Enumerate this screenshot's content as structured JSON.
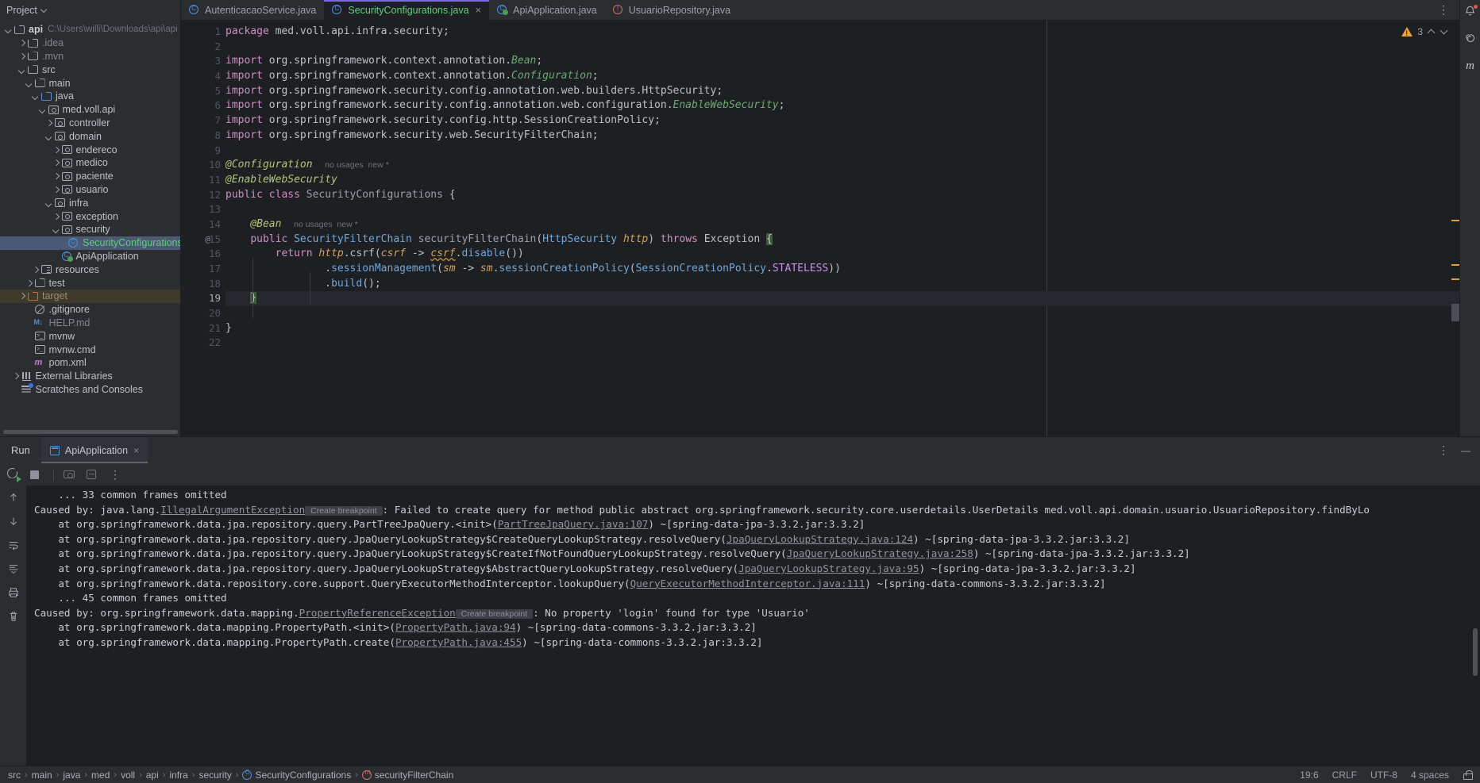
{
  "sidebar": {
    "title": "Project",
    "title_icon": "chevron-down-icon",
    "root": {
      "label": "api",
      "path": "C:\\Users\\willi\\Downloads\\api\\api"
    },
    "items": [
      {
        "label": ".idea",
        "icon": "folder-icon",
        "indent": 2,
        "arrow": "right",
        "style": "dim"
      },
      {
        "label": ".mvn",
        "icon": "folder-icon",
        "indent": 2,
        "arrow": "right",
        "style": "dim"
      },
      {
        "label": "src",
        "icon": "folder-icon",
        "indent": 2,
        "arrow": "down",
        "style": ""
      },
      {
        "label": "main",
        "icon": "folder-icon",
        "indent": 3,
        "arrow": "down",
        "style": ""
      },
      {
        "label": "java",
        "icon": "folder-blue-icon",
        "indent": 4,
        "arrow": "down",
        "style": ""
      },
      {
        "label": "med.voll.api",
        "icon": "package-icon",
        "indent": 5,
        "arrow": "down",
        "style": ""
      },
      {
        "label": "controller",
        "icon": "package-icon",
        "indent": 6,
        "arrow": "right",
        "style": ""
      },
      {
        "label": "domain",
        "icon": "package-icon",
        "indent": 6,
        "arrow": "down",
        "style": ""
      },
      {
        "label": "endereco",
        "icon": "package-icon",
        "indent": 7,
        "arrow": "right",
        "style": ""
      },
      {
        "label": "medico",
        "icon": "package-icon",
        "indent": 7,
        "arrow": "right",
        "style": ""
      },
      {
        "label": "paciente",
        "icon": "package-icon",
        "indent": 7,
        "arrow": "right",
        "style": ""
      },
      {
        "label": "usuario",
        "icon": "package-icon",
        "indent": 7,
        "arrow": "right",
        "style": ""
      },
      {
        "label": "infra",
        "icon": "package-icon",
        "indent": 6,
        "arrow": "down",
        "style": ""
      },
      {
        "label": "exception",
        "icon": "package-icon",
        "indent": 7,
        "arrow": "right",
        "style": ""
      },
      {
        "label": "security",
        "icon": "package-icon",
        "indent": 7,
        "arrow": "down",
        "style": ""
      },
      {
        "label": "SecurityConfigurations",
        "icon": "java-class-icon",
        "indent": 8,
        "arrow": "none",
        "style": "green",
        "selected": true
      },
      {
        "label": "ApiApplication",
        "icon": "spring-class-icon",
        "indent": 7,
        "arrow": "none",
        "style": ""
      },
      {
        "label": "resources",
        "icon": "resources-icon",
        "indent": 4,
        "arrow": "right",
        "style": ""
      },
      {
        "label": "test",
        "icon": "folder-icon",
        "indent": 3,
        "arrow": "right",
        "style": ""
      },
      {
        "label": "target",
        "icon": "folder-orange-icon",
        "indent": 2,
        "arrow": "right",
        "style": "tan",
        "target": true
      },
      {
        "label": ".gitignore",
        "icon": "gitignore-icon",
        "indent": 3,
        "arrow": "none",
        "style": ""
      },
      {
        "label": "HELP.md",
        "icon": "markdown-icon",
        "indent": 3,
        "arrow": "none",
        "style": "dim"
      },
      {
        "label": "mvnw",
        "icon": "terminal-icon",
        "indent": 3,
        "arrow": "none",
        "style": ""
      },
      {
        "label": "mvnw.cmd",
        "icon": "terminal-icon",
        "indent": 3,
        "arrow": "none",
        "style": ""
      },
      {
        "label": "pom.xml",
        "icon": "xml-icon",
        "indent": 3,
        "arrow": "none",
        "style": ""
      },
      {
        "label": "External Libraries",
        "icon": "library-icon",
        "indent": 1,
        "arrow": "right",
        "style": ""
      },
      {
        "label": "Scratches and Consoles",
        "icon": "scratches-icon",
        "indent": 1,
        "arrow": "none",
        "style": ""
      }
    ]
  },
  "editor": {
    "tabs": [
      {
        "label": "AutenticacaoService.java",
        "icon": "java-class-icon",
        "active": false,
        "closable": false
      },
      {
        "label": "SecurityConfigurations.java",
        "icon": "java-class-icon",
        "active": true,
        "closable": true
      },
      {
        "label": "ApiApplication.java",
        "icon": "spring-class-icon",
        "active": false,
        "closable": false
      },
      {
        "label": "UsuarioRepository.java",
        "icon": "interface-icon",
        "active": false,
        "closable": false
      }
    ],
    "tab_close_label": "×",
    "tab_menu_label": "⋮",
    "inspection": {
      "warning_count": "3",
      "icon": "warning-triangle-icon"
    },
    "line_numbers": [
      "1",
      "2",
      "3",
      "4",
      "5",
      "6",
      "7",
      "8",
      "9",
      "10",
      "11",
      "12",
      "13",
      "14",
      "15",
      "16",
      "17",
      "18",
      "19",
      "20",
      "21",
      "22"
    ],
    "current_line": 19,
    "gutter_marks": {
      "15": "@"
    },
    "code_lines": [
      "package med.voll.api.infra.security;",
      "",
      "import org.springframework.context.annotation.Bean;",
      "import org.springframework.context.annotation.Configuration;",
      "import org.springframework.security.config.annotation.web.builders.HttpSecurity;",
      "import org.springframework.security.config.annotation.web.configuration.EnableWebSecurity;",
      "import org.springframework.security.config.http.SessionCreationPolicy;",
      "import org.springframework.security.web.SecurityFilterChain;",
      "",
      "@Configuration",
      "@EnableWebSecurity",
      "public class SecurityConfigurations {",
      "",
      "    @Bean",
      "    public SecurityFilterChain securityFilterChain(HttpSecurity http) throws Exception {",
      "        return http.csrf(csrf -> csrf.disable())",
      "                .sessionManagement(sm -> sm.sessionCreationPolicy(SessionCreationPolicy.STATELESS))",
      "                .build();",
      "    }",
      "",
      "}",
      ""
    ],
    "inlay_hints": {
      "line10": "no usages   new *",
      "line14": "no usages   new *"
    }
  },
  "run": {
    "panel_title": "Run",
    "tab_label": "ApiApplication",
    "tab_close_label": "×",
    "toolbar": {
      "rerun": "rerun-icon",
      "stop": "stop-icon",
      "screenshot": "camera-icon",
      "export": "export-icon",
      "more": "⋮"
    },
    "panel_menu_label": "⋮",
    "panel_minimize_label": "—",
    "gutter_icons": [
      "arrow-up-icon",
      "arrow-down-icon",
      "soft-wrap-icon",
      "scroll-end-icon",
      "print-icon",
      "trash-icon"
    ],
    "console_lines": [
      {
        "parts": [
          {
            "t": "\t... 33 common frames omitted",
            "c": "plain"
          }
        ]
      },
      {
        "parts": [
          {
            "t": "Caused by: java.lang.",
            "c": "plain"
          },
          {
            "t": "IllegalArgumentException",
            "c": "link"
          },
          {
            "t": "Create breakpoint",
            "c": "bp"
          },
          {
            "t": ": Failed to create query for method public abstract org.springframework.security.core.userdetails.UserDetails med.voll.api.domain.usuario.UsuarioRepository.findByLo",
            "c": "plain"
          }
        ]
      },
      {
        "parts": [
          {
            "t": "\tat org.springframework.data.jpa.repository.query.PartTreeJpaQuery.<init>(",
            "c": "plain"
          },
          {
            "t": "PartTreeJpaQuery.java:107",
            "c": "link"
          },
          {
            "t": ") ~[spring-data-jpa-3.3.2.jar:3.3.2]",
            "c": "plain"
          }
        ]
      },
      {
        "parts": [
          {
            "t": "\tat org.springframework.data.jpa.repository.query.JpaQueryLookupStrategy$CreateQueryLookupStrategy.resolveQuery(",
            "c": "plain"
          },
          {
            "t": "JpaQueryLookupStrategy.java:124",
            "c": "link"
          },
          {
            "t": ") ~[spring-data-jpa-3.3.2.jar:3.3.2]",
            "c": "plain"
          }
        ]
      },
      {
        "parts": [
          {
            "t": "\tat org.springframework.data.jpa.repository.query.JpaQueryLookupStrategy$CreateIfNotFoundQueryLookupStrategy.resolveQuery(",
            "c": "plain"
          },
          {
            "t": "JpaQueryLookupStrategy.java:258",
            "c": "link"
          },
          {
            "t": ") ~[spring-data-jpa-3.3.2.jar:3.3.2]",
            "c": "plain"
          }
        ]
      },
      {
        "parts": [
          {
            "t": "\tat org.springframework.data.jpa.repository.query.JpaQueryLookupStrategy$AbstractQueryLookupStrategy.resolveQuery(",
            "c": "plain"
          },
          {
            "t": "JpaQueryLookupStrategy.java:95",
            "c": "link"
          },
          {
            "t": ") ~[spring-data-jpa-3.3.2.jar:3.3.2]",
            "c": "plain"
          }
        ]
      },
      {
        "parts": [
          {
            "t": "\tat org.springframework.data.repository.core.support.QueryExecutorMethodInterceptor.lookupQuery(",
            "c": "plain"
          },
          {
            "t": "QueryExecutorMethodInterceptor.java:111",
            "c": "link"
          },
          {
            "t": ") ~[spring-data-commons-3.3.2.jar:3.3.2]",
            "c": "plain"
          }
        ]
      },
      {
        "parts": [
          {
            "t": "\t... 45 common frames omitted",
            "c": "plain"
          }
        ]
      },
      {
        "parts": [
          {
            "t": "Caused by: org.springframework.data.mapping.",
            "c": "plain"
          },
          {
            "t": "PropertyReferenceException",
            "c": "link"
          },
          {
            "t": "Create breakpoint",
            "c": "bp"
          },
          {
            "t": ": No property 'login' found for type 'Usuario'",
            "c": "plain"
          }
        ]
      },
      {
        "parts": [
          {
            "t": "\tat org.springframework.data.mapping.PropertyPath.<init>(",
            "c": "plain"
          },
          {
            "t": "PropertyPath.java:94",
            "c": "link"
          },
          {
            "t": ") ~[spring-data-commons-3.3.2.jar:3.3.2]",
            "c": "plain"
          }
        ]
      },
      {
        "parts": [
          {
            "t": "\tat org.springframework.data.mapping.PropertyPath.create(",
            "c": "plain"
          },
          {
            "t": "PropertyPath.java:455",
            "c": "link"
          },
          {
            "t": ") ~[spring-data-commons-3.3.2.jar:3.3.2]",
            "c": "plain"
          }
        ]
      }
    ]
  },
  "status_bar": {
    "breadcrumbs": [
      {
        "label": "src",
        "icon": ""
      },
      {
        "label": "main",
        "icon": ""
      },
      {
        "label": "java",
        "icon": ""
      },
      {
        "label": "med",
        "icon": ""
      },
      {
        "label": "voll",
        "icon": ""
      },
      {
        "label": "api",
        "icon": ""
      },
      {
        "label": "infra",
        "icon": ""
      },
      {
        "label": "security",
        "icon": ""
      },
      {
        "label": "SecurityConfigurations",
        "icon": "class-icon"
      },
      {
        "label": "securityFilterChain",
        "icon": "method-icon"
      }
    ],
    "separator": "›",
    "caret": "19:6",
    "line_separator": "CRLF",
    "encoding": "UTF-8",
    "indent": "4 spaces",
    "lock_icon": "lock-icon"
  },
  "colors": {
    "bg_panel": "#2b2d30",
    "bg_editor": "#1e1f22",
    "accent_purple": "#7b68ee",
    "selection_blue": "#4b5975",
    "warning_orange": "#d9a13b",
    "green_text": "#5fd07a"
  }
}
